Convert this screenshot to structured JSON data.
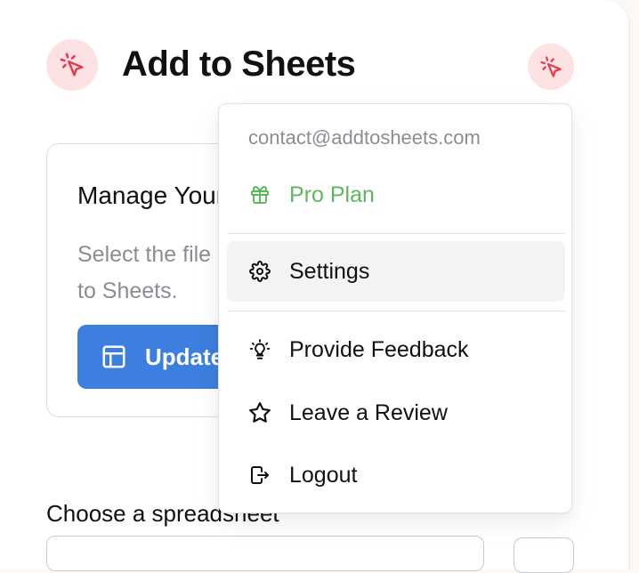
{
  "app": {
    "title": "Add to Sheets"
  },
  "card": {
    "title": "Manage Your Sheets",
    "description": "Select the file and add it to Sheets.",
    "button_label": "Update"
  },
  "form": {
    "spreadsheet_label": "Choose a spreadsheet"
  },
  "menu": {
    "email": "contact@addtosheets.com",
    "plan": "Pro Plan",
    "settings": "Settings",
    "feedback": "Provide Feedback",
    "review": "Leave a Review",
    "logout": "Logout"
  },
  "colors": {
    "brand_accent": "#e8394d",
    "brand_bg": "#fde2e4",
    "primary_button": "#3d7fde",
    "plan_green": "#5cb85c"
  },
  "icons": {
    "logo": "cursor-click-icon",
    "update_button": "table-icon",
    "plan": "gift-icon",
    "settings": "gear-icon",
    "feedback": "lightbulb-icon",
    "review": "star-icon",
    "logout": "logout-icon"
  }
}
